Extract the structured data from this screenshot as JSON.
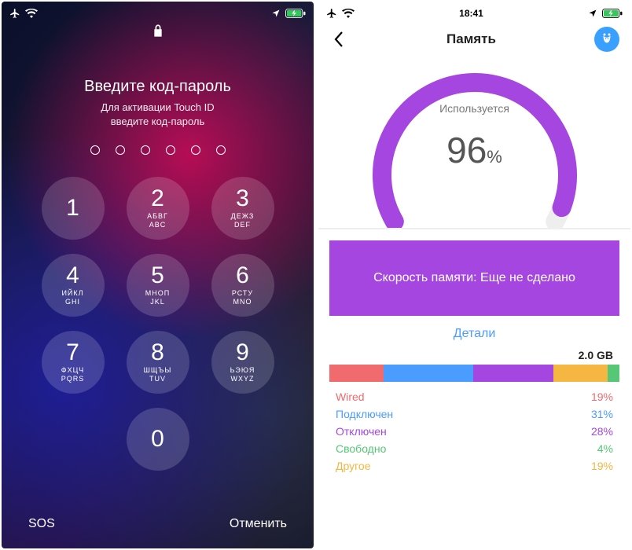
{
  "lock": {
    "title": "Введите код-пароль",
    "subtitle_line1": "Для активации Touch ID",
    "subtitle_line2": "введите код-пароль",
    "passcode_length": 6,
    "keys": [
      {
        "num": "1",
        "ru": "",
        "en": ""
      },
      {
        "num": "2",
        "ru": "АБВГ",
        "en": "ABC"
      },
      {
        "num": "3",
        "ru": "ДЕЖЗ",
        "en": "DEF"
      },
      {
        "num": "4",
        "ru": "ИЙКЛ",
        "en": "GHI"
      },
      {
        "num": "5",
        "ru": "МНОП",
        "en": "JKL"
      },
      {
        "num": "6",
        "ru": "РСТУ",
        "en": "MNO"
      },
      {
        "num": "7",
        "ru": "ФХЦЧ",
        "en": "PQRS"
      },
      {
        "num": "8",
        "ru": "ШЩЪЫ",
        "en": "TUV"
      },
      {
        "num": "9",
        "ru": "ЬЭЮЯ",
        "en": "WXYZ"
      },
      {
        "num": "0",
        "ru": "",
        "en": ""
      }
    ],
    "sos": "SOS",
    "cancel": "Отменить"
  },
  "mem": {
    "time": "18:41",
    "title": "Память",
    "gauge_label": "Используется",
    "gauge_value": "96",
    "gauge_pct": "%",
    "speed_label": "Скорость памяти: Еще не сделано",
    "details_title": "Детали",
    "total": "2.0 GB",
    "segments": [
      {
        "name": "Wired",
        "pct": 19,
        "color": "#f06a6e"
      },
      {
        "name": "Подключен",
        "pct": 31,
        "color": "#4a9cff"
      },
      {
        "name": "Отключен",
        "pct": 28,
        "color": "#a546e0"
      },
      {
        "name": "Свободно",
        "pct": 4,
        "color": "#55c776"
      },
      {
        "name": "Другое",
        "pct": 19,
        "color": "#f5b642"
      }
    ]
  },
  "chart_data": {
    "type": "pie",
    "title": "Память — Используется 96%",
    "categories": [
      "Wired",
      "Подключен",
      "Отключен",
      "Свободно",
      "Другое"
    ],
    "values": [
      19,
      31,
      28,
      4,
      19
    ],
    "colors": [
      "#f06a6e",
      "#4a9cff",
      "#a546e0",
      "#55c776",
      "#f5b642"
    ],
    "total_label": "2.0 GB",
    "gauge_percent": 96
  }
}
